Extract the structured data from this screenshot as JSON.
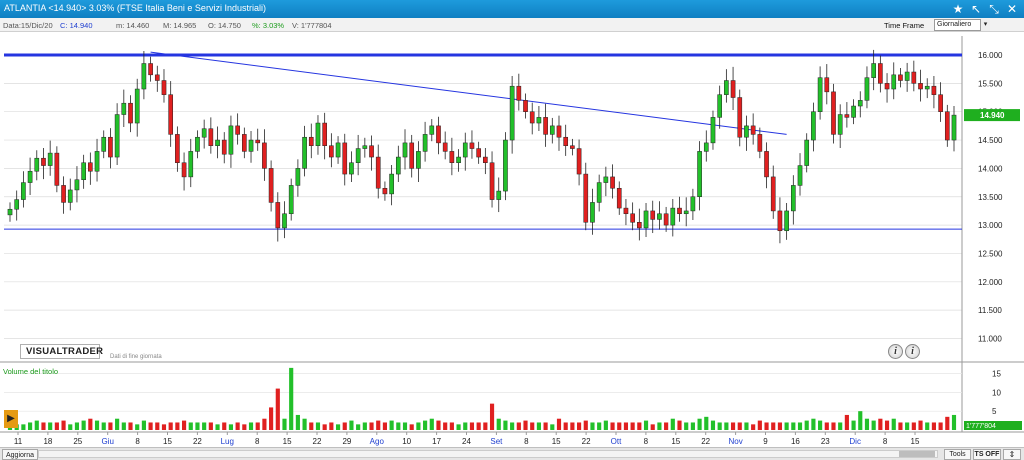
{
  "header": {
    "title": "ATLANTIA <14.940> 3.03%  (FTSE Italia Beni e Servizi Industriali)",
    "icons": [
      "star-icon",
      "arrow-up-left-icon",
      "resize-icon",
      "close-icon"
    ]
  },
  "infobar": {
    "date": "Data:15/Dic/20",
    "close": "C: 14.940",
    "min": "m: 14.460",
    "max": "M: 14.965",
    "open": "O: 14.750",
    "pct": "%: 3.03%",
    "volume": "V: 1'777804",
    "timeframe_label": "Time Frame",
    "timeframe_value": "Giornaliero"
  },
  "branding": {
    "logo": "VISUALTRADER",
    "subtitle": "Dati di fine giornata"
  },
  "volume_panel": {
    "label": "Volume del titolo",
    "current_value": "1'777'804"
  },
  "bottombar": {
    "refresh": "Aggiorna",
    "tools": "Tools",
    "ts_off": "TS OFF",
    "extra": "⇕"
  },
  "colors": {
    "up": "#22c02a",
    "down": "#e02020",
    "line": "#2535e0",
    "price_box": "#1faf1f"
  },
  "chart_data": {
    "type": "candlestick",
    "price_axis": {
      "min": 11.0,
      "max": 16.0,
      "ticks": [
        "16.000",
        "15.500",
        "15.000",
        "14.500",
        "14.000",
        "13.500",
        "13.000",
        "12.500",
        "12.000",
        "11.500",
        "11.000"
      ]
    },
    "current_price_label": "14.940",
    "x_axis": {
      "labels": [
        {
          "t": "11",
          "m": false
        },
        {
          "t": "18",
          "m": false
        },
        {
          "t": "25",
          "m": false
        },
        {
          "t": "Giu",
          "m": true
        },
        {
          "t": "8",
          "m": false
        },
        {
          "t": "15",
          "m": false
        },
        {
          "t": "22",
          "m": false
        },
        {
          "t": "Lug",
          "m": true
        },
        {
          "t": "8",
          "m": false
        },
        {
          "t": "15",
          "m": false
        },
        {
          "t": "22",
          "m": false
        },
        {
          "t": "29",
          "m": false
        },
        {
          "t": "Ago",
          "m": true
        },
        {
          "t": "10",
          "m": false
        },
        {
          "t": "17",
          "m": false
        },
        {
          "t": "24",
          "m": false
        },
        {
          "t": "Set",
          "m": true
        },
        {
          "t": "8",
          "m": false
        },
        {
          "t": "15",
          "m": false
        },
        {
          "t": "22",
          "m": false
        },
        {
          "t": "Ott",
          "m": true
        },
        {
          "t": "8",
          "m": false
        },
        {
          "t": "15",
          "m": false
        },
        {
          "t": "22",
          "m": false
        },
        {
          "t": "Nov",
          "m": true
        },
        {
          "t": "9",
          "m": false
        },
        {
          "t": "16",
          "m": false
        },
        {
          "t": "23",
          "m": false
        },
        {
          "t": "Dic",
          "m": true
        },
        {
          "t": "8",
          "m": false
        },
        {
          "t": "15",
          "m": false
        }
      ]
    },
    "volume_axis": {
      "min": 0,
      "max": 17,
      "ticks": [
        "15",
        "10",
        "5"
      ]
    },
    "close": [
      13.28,
      13.45,
      13.75,
      13.95,
      14.18,
      14.05,
      14.27,
      13.7,
      13.4,
      13.62,
      13.8,
      14.1,
      13.95,
      14.3,
      14.55,
      14.2,
      14.95,
      15.15,
      14.8,
      15.4,
      15.85,
      15.65,
      15.55,
      15.3,
      14.6,
      14.1,
      13.85,
      14.3,
      14.55,
      14.7,
      14.4,
      14.5,
      14.25,
      14.75,
      14.6,
      14.3,
      14.5,
      14.45,
      14.0,
      13.4,
      12.95,
      13.2,
      13.7,
      14.0,
      14.55,
      14.4,
      14.8,
      14.4,
      14.2,
      14.45,
      13.9,
      14.1,
      14.35,
      14.4,
      14.2,
      13.65,
      13.55,
      13.9,
      14.2,
      14.45,
      14.0,
      14.3,
      14.6,
      14.75,
      14.45,
      14.3,
      14.1,
      14.2,
      14.45,
      14.35,
      14.2,
      14.1,
      13.45,
      13.6,
      14.5,
      15.45,
      15.2,
      15.0,
      14.8,
      14.9,
      14.6,
      14.75,
      14.55,
      14.4,
      14.35,
      13.9,
      13.05,
      13.4,
      13.75,
      13.85,
      13.65,
      13.3,
      13.2,
      13.05,
      12.95,
      13.25,
      13.1,
      13.2,
      13.0,
      13.3,
      13.2,
      13.25,
      13.5,
      14.3,
      14.45,
      14.9,
      15.3,
      15.55,
      15.25,
      14.55,
      14.75,
      14.6,
      14.3,
      13.85,
      13.25,
      12.9,
      13.25,
      13.7,
      14.05,
      14.5,
      15.0,
      15.6,
      15.35,
      14.6,
      14.95,
      14.9,
      15.1,
      15.2,
      15.6,
      15.85,
      15.5,
      15.4,
      15.65,
      15.55,
      15.7,
      15.5,
      15.4,
      15.45,
      15.3,
      15.0,
      14.5,
      14.94
    ],
    "volume": [
      2,
      1.5,
      1.5,
      2,
      2.5,
      2,
      2,
      2,
      2.5,
      1.5,
      2,
      2.5,
      3,
      2.5,
      2,
      2,
      3,
      2,
      2,
      1.5,
      2.5,
      2,
      2,
      1.5,
      2,
      2,
      2.5,
      2,
      2,
      2,
      2,
      1.5,
      2,
      1.5,
      2,
      1.5,
      2,
      2,
      3,
      6,
      11,
      3,
      16.5,
      4,
      3,
      2,
      2,
      1.5,
      2,
      1.5,
      2,
      2.5,
      1.5,
      2,
      2,
      2.5,
      2,
      2.5,
      2,
      2,
      1.5,
      2,
      2.5,
      3,
      2.5,
      2,
      2,
      1.5,
      2,
      2,
      2,
      2,
      7,
      3,
      2.5,
      2,
      2,
      2.5,
      2,
      2,
      2,
      1.5,
      3,
      2,
      2,
      2,
      2.5,
      2,
      2,
      2.5,
      2,
      2,
      2,
      2,
      2,
      2.5,
      1.5,
      2,
      2,
      3,
      2.5,
      2,
      2,
      3,
      3.5,
      2.5,
      2,
      2,
      2,
      2,
      2,
      1.5,
      2.5,
      2,
      2,
      2,
      2,
      2,
      2,
      2.5,
      3,
      2.5,
      2,
      2,
      2,
      4,
      2.5,
      5,
      3,
      2.5,
      3,
      2.5,
      3,
      2,
      2,
      2,
      2.5,
      2,
      2,
      2,
      3.5,
      4,
      2,
      2
    ],
    "trendline": {
      "from": {
        "bar": 21,
        "price": 16.05
      },
      "to": {
        "bar": 116,
        "price": 14.6
      }
    },
    "horizontal_lines": [
      {
        "price": 16.0,
        "style": "thick"
      },
      {
        "price": 12.93,
        "style": "thin"
      }
    ]
  }
}
